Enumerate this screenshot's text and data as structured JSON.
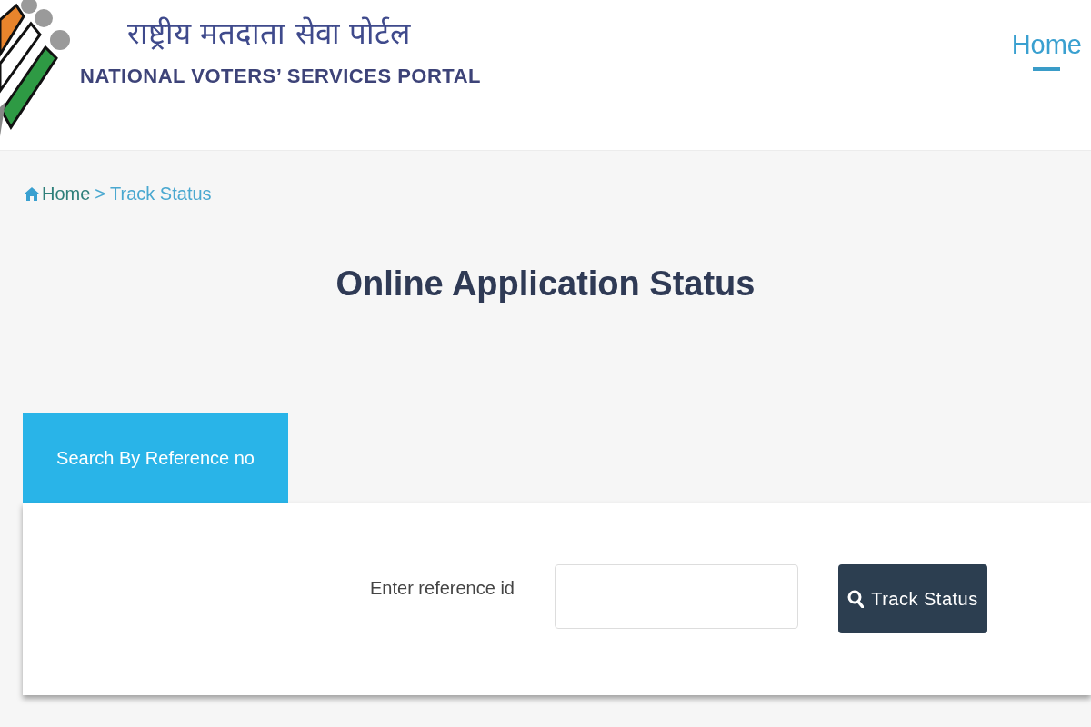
{
  "header": {
    "title_hindi": "राष्ट्रीय मतदाता सेवा पोर्टल",
    "title_english": "NATIONAL VOTERS’ SERVICES PORTAL",
    "nav": [
      {
        "label": "Home",
        "selected": true
      }
    ]
  },
  "breadcrumb": {
    "items": [
      "Home",
      "Track Status"
    ],
    "separator": ">"
  },
  "page_title": "Online Application Status",
  "tabs": [
    {
      "label": "Search By Reference no",
      "selected": true
    }
  ],
  "form": {
    "label": "Enter reference id",
    "button": "Track Status"
  }
}
